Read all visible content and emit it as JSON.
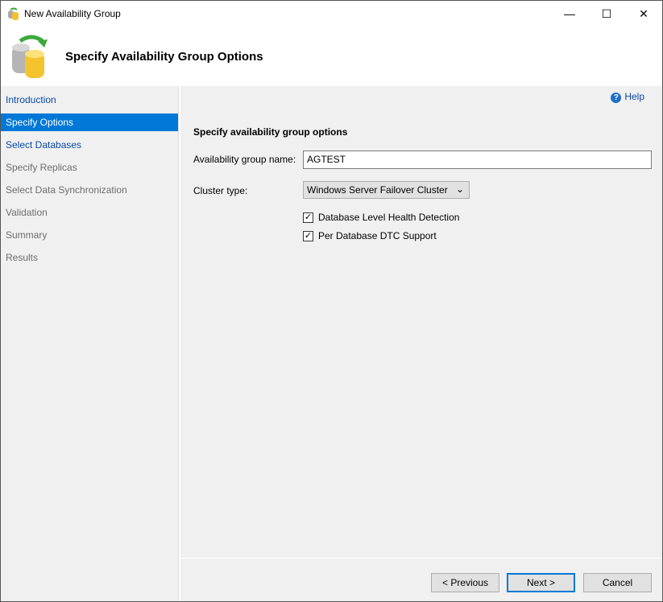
{
  "window": {
    "title": "New Availability Group",
    "minimize": "—",
    "maximize": "☐",
    "close": "✕"
  },
  "header": {
    "title": "Specify Availability Group Options"
  },
  "sidebar": {
    "items": [
      {
        "label": "Introduction",
        "state": "link"
      },
      {
        "label": "Specify Options",
        "state": "selected"
      },
      {
        "label": "Select Databases",
        "state": "link"
      },
      {
        "label": "Specify Replicas",
        "state": "disabled"
      },
      {
        "label": "Select Data Synchronization",
        "state": "disabled"
      },
      {
        "label": "Validation",
        "state": "disabled"
      },
      {
        "label": "Summary",
        "state": "disabled"
      },
      {
        "label": "Results",
        "state": "disabled"
      }
    ]
  },
  "main": {
    "help": "Help",
    "section_title": "Specify availability group options",
    "name_label": "Availability group name:",
    "name_value": "AGTEST",
    "cluster_label": "Cluster type:",
    "cluster_value": "Windows Server Failover Cluster",
    "checkboxes": [
      {
        "label": "Database Level Health Detection",
        "checked": true
      },
      {
        "label": "Per Database DTC Support",
        "checked": true
      }
    ]
  },
  "buttons": {
    "previous": "< Previous",
    "next": "Next >",
    "cancel": "Cancel"
  }
}
